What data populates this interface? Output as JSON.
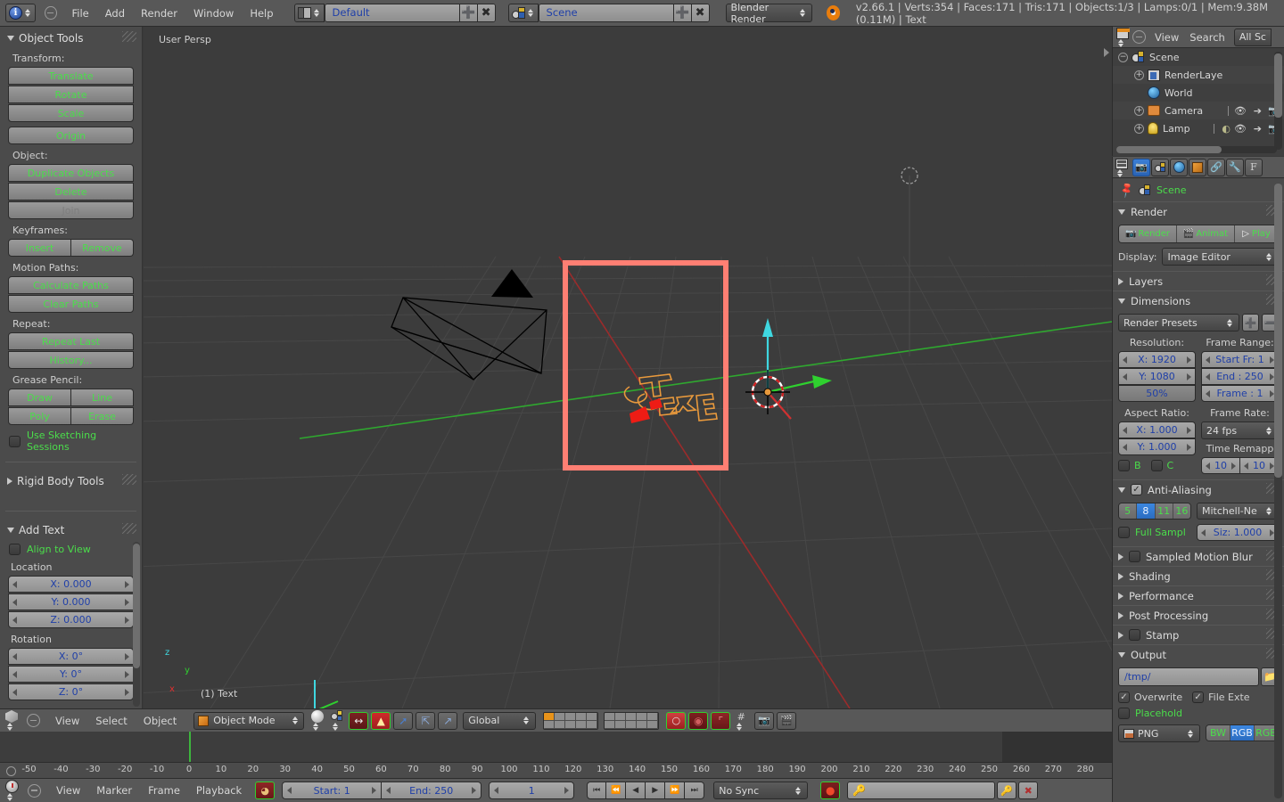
{
  "topbar": {
    "menus": [
      "File",
      "Add",
      "Render",
      "Window",
      "Help"
    ],
    "screen_layout": "Default",
    "scene_name": "Scene",
    "engine": "Blender Render",
    "stats": "v2.66.1 | Verts:354 | Faces:171 | Tris:171 | Objects:1/3 | Lamps:0/1 | Mem:9.38M (0.11M) | Text",
    "add_icon": "plus-icon",
    "remove_icon": "x-icon",
    "editor_icon": "info-editor-icon",
    "scene_icon": "scene-icon",
    "logo_icon": "blender-logo-icon"
  },
  "tool_panel": {
    "title": "Object Tools",
    "sections": [
      {
        "label": "Transform:",
        "buttons": [
          "Translate",
          "Rotate",
          "Scale"
        ]
      },
      {
        "label": "",
        "buttons": [
          "Origin"
        ]
      },
      {
        "label": "Object:",
        "buttons": [
          "Duplicate Objects",
          "Delete",
          "Join"
        ]
      },
      {
        "label": "Keyframes:",
        "buttons": [
          "Insert",
          "Remove"
        ]
      },
      {
        "label": "Motion Paths:",
        "buttons": [
          "Calculate Paths",
          "Clear Paths"
        ]
      },
      {
        "label": "Repeat:",
        "buttons": [
          "Repeat Last",
          "History..."
        ]
      },
      {
        "label": "Grease Pencil:",
        "buttons": [
          "Draw",
          "Line",
          "Poly",
          "Erase"
        ]
      }
    ],
    "transform_label": "Transform:",
    "b_translate": "Translate",
    "b_rotate": "Rotate",
    "b_scale": "Scale",
    "b_origin": "Origin",
    "object_label": "Object:",
    "b_duplicate": "Duplicate Objects",
    "b_delete": "Delete",
    "b_join": "Join",
    "keyframes_label": "Keyframes:",
    "b_insert": "Insert",
    "b_remove": "Remove",
    "motion_label": "Motion Paths:",
    "b_calcpaths": "Calculate Paths",
    "b_clearpaths": "Clear Paths",
    "repeat_label": "Repeat:",
    "b_repeatlast": "Repeat Last",
    "b_history": "History...",
    "grease_label": "Grease Pencil:",
    "b_draw": "Draw",
    "b_line": "Line",
    "b_poly": "Poly",
    "b_erase": "Erase",
    "sketching_label": "Use Sketching Sessions",
    "rigid_body_label": "Rigid Body Tools"
  },
  "add_text_panel": {
    "title": "Add Text",
    "align_label": "Align to View",
    "location_label": "Location",
    "loc_x": "X: 0.000",
    "loc_y": "Y: 0.000",
    "loc_z": "Z: 0.000",
    "rotation_label": "Rotation",
    "rot_x": "X: 0°",
    "rot_y": "Y: 0°",
    "rot_z": "Z: 0°"
  },
  "viewport": {
    "view_label": "User Persp",
    "object_label": "(1) Text",
    "axis_x": "x",
    "axis_y": "y",
    "axis_z": "z",
    "selection_box_color": "#ff7f73",
    "grid_color": "#4a4a4a",
    "x_axis_color": "#9b2b2b",
    "y_axis_color": "#2fa82f",
    "object_outline_color": "#e8993c"
  },
  "viewport_header": {
    "menus": [
      "View",
      "Select",
      "Object"
    ],
    "mode": "Object Mode",
    "orientation": "Global",
    "editor_icon": "3d-view-icon",
    "shading_icon": "shading-solid-icon",
    "pivot_icon": "pivot-median-icon",
    "manip_icon": "manipulator-toggle-icon",
    "translate_icon": "manipulator-translate-icon",
    "rotate_icon": "manipulator-rotate-icon",
    "scale_icon": "manipulator-scale-icon",
    "snap_icon": "snap-magnet-icon",
    "prop_edit_icon": "proportional-edit-icon",
    "render_icon": "render-icon",
    "animation_icon": "render-animation-icon",
    "layers_label": "scene-layers"
  },
  "timeline": {
    "ticks": [
      "-50",
      "-40",
      "-30",
      "-20",
      "-10",
      "0",
      "10",
      "20",
      "30",
      "40",
      "50",
      "60",
      "70",
      "80",
      "90",
      "100",
      "110",
      "120",
      "130",
      "140",
      "150",
      "160",
      "170",
      "180",
      "190",
      "200",
      "210",
      "220",
      "230",
      "240",
      "250",
      "260",
      "270",
      "280"
    ],
    "menus": [
      "View",
      "Marker",
      "Frame",
      "Playback"
    ],
    "start_label": "Start: 1",
    "end_label": "End: 250",
    "current_frame": "1",
    "sync_mode": "No Sync",
    "editor_icon": "timeline-icon",
    "record_icon": "record-icon",
    "keyingset_icon": "keying-set-icon",
    "nav_buttons": [
      "jump-start-icon",
      "play-reverse-icon",
      "frame-back-icon",
      "play-icon",
      "frame-forward-icon",
      "jump-end-icon"
    ]
  },
  "outliner": {
    "view_menu": "View",
    "search_menu": "Search",
    "display_mode": "All Sc",
    "editor_icon": "outliner-icon",
    "rows": [
      {
        "label": "Scene",
        "icon": "scene-icon",
        "indent": 0,
        "expander": "minus"
      },
      {
        "label": "RenderLaye",
        "icon": "renderlayers-icon",
        "indent": 1,
        "expander": "plus"
      },
      {
        "label": "World",
        "icon": "world-icon",
        "indent": 1,
        "expander": "none"
      },
      {
        "label": "Camera",
        "icon": "camera-icon",
        "indent": 1,
        "expander": "plus"
      },
      {
        "label": "Lamp",
        "icon": "lamp-icon",
        "indent": 1,
        "expander": "plus"
      }
    ]
  },
  "properties": {
    "tabs": [
      "render-tab-icon",
      "scene-tab-icon",
      "world-tab-icon",
      "object-tab-icon",
      "constraints-tab-icon",
      "modifiers-tab-icon",
      "data-tab-icon"
    ],
    "pin_icon": "pin-icon",
    "breadcrumb": "Scene",
    "render": {
      "title": "Render",
      "render_btn": "Render",
      "animation_btn": "Animat",
      "play_btn": "Play",
      "display_label": "Display:",
      "display_value": "Image Editor"
    },
    "layers": {
      "title": "Layers"
    },
    "dimensions": {
      "title": "Dimensions",
      "preset": "Render Presets",
      "resolution_label": "Resolution:",
      "res_x": "X: 1920",
      "res_y": "Y: 1080",
      "res_percent": "50%",
      "frame_range_label": "Frame Range:",
      "start_frame": "Start Fr: 1",
      "end_frame": "End : 250",
      "frame_step": "Frame : 1",
      "aspect_label": "Aspect Ratio:",
      "aspect_x": "X: 1.000",
      "aspect_y": "Y: 1.000",
      "border_label": "B",
      "crop_label": "C",
      "framerate_label": "Frame Rate:",
      "framerate": "24 fps",
      "remap_label": "Time Remapp",
      "remap_old": "10",
      "remap_new": "10"
    },
    "antialiasing": {
      "title": "Anti-Aliasing",
      "samples": [
        "5",
        "8",
        "11",
        "16"
      ],
      "selected_sample": "8",
      "filter": "Mitchell-Ne",
      "full_sample_label": "Full Sampl",
      "size": "Siz: 1.000"
    },
    "collapsed": [
      {
        "title": "Sampled Motion Blur",
        "has_checkbox": true
      },
      {
        "title": "Shading",
        "has_checkbox": false
      },
      {
        "title": "Performance",
        "has_checkbox": false
      },
      {
        "title": "Post Processing",
        "has_checkbox": false
      },
      {
        "title": "Stamp",
        "has_checkbox": true
      }
    ],
    "output": {
      "title": "Output",
      "path": "/tmp/",
      "folder_icon": "folder-icon",
      "overwrite_label": "Overwrite",
      "file_ext_label": "File Exte",
      "placeholder_label": "Placehold",
      "format": "PNG",
      "color_modes": [
        "BW",
        "RGB",
        "RGB"
      ],
      "selected_color_mode": "RGB"
    }
  }
}
